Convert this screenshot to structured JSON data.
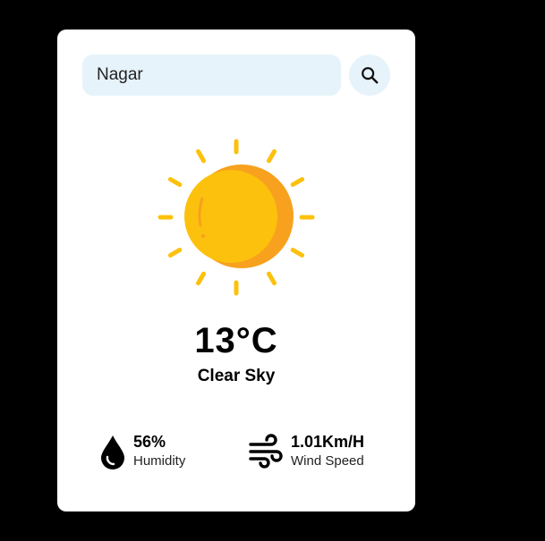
{
  "search": {
    "value": "Nagar",
    "icon": "search-icon"
  },
  "weather": {
    "icon": "sun-icon",
    "temperature": "13°C",
    "description": "Clear Sky"
  },
  "stats": {
    "humidity": {
      "icon": "water-drop-icon",
      "value": "56%",
      "label": "Humidity"
    },
    "wind": {
      "icon": "wind-icon",
      "value": "1.01Km/H",
      "label": "Wind Speed"
    }
  },
  "colors": {
    "background": "#000000",
    "card": "#ffffff",
    "input_bg": "#e6f3fa",
    "sun_main": "#fcc10c",
    "sun_shade": "#f7a11f",
    "sun_rays": "#fcc10c"
  }
}
